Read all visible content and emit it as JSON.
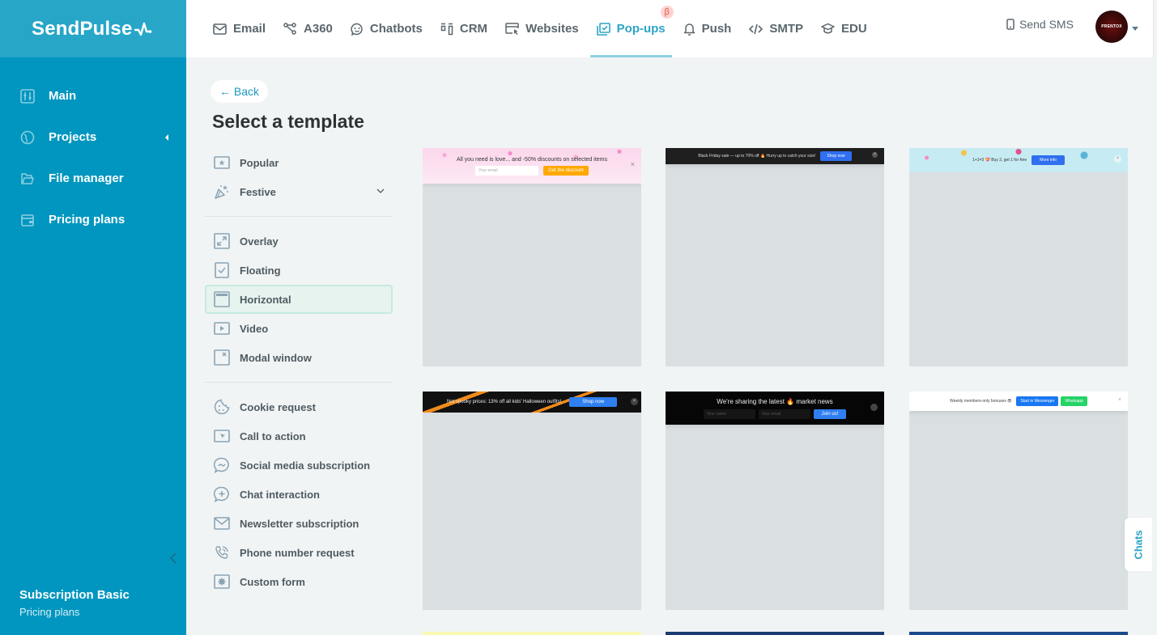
{
  "brand": {
    "name": "SendPulse",
    "primary": "#0096bf",
    "accent": "#2ba5c6"
  },
  "sidebar": {
    "items": [
      {
        "label": "Main",
        "icon": "sliders-icon"
      },
      {
        "label": "Projects",
        "icon": "globe-icon"
      },
      {
        "label": "File manager",
        "icon": "folder-icon"
      },
      {
        "label": "Pricing plans",
        "icon": "wallet-icon"
      }
    ],
    "plan": {
      "title": "Subscription Basic",
      "subtitle": "Pricing plans"
    }
  },
  "topnav": {
    "items": [
      {
        "label": "Email",
        "icon": "envelope-icon"
      },
      {
        "label": "A360",
        "icon": "flow-icon"
      },
      {
        "label": "Chatbots",
        "icon": "chatbot-icon"
      },
      {
        "label": "CRM",
        "icon": "crm-icon"
      },
      {
        "label": "Websites",
        "icon": "website-icon"
      },
      {
        "label": "Pop-ups",
        "icon": "popup-icon",
        "active": true,
        "badge": "β"
      },
      {
        "label": "Push",
        "icon": "bell-icon"
      },
      {
        "label": "SMTP",
        "icon": "code-icon"
      },
      {
        "label": "EDU",
        "icon": "graduation-cap-icon"
      }
    ],
    "send_sms": "Send SMS",
    "avatar_text": "PRENTOX"
  },
  "main": {
    "back": "← Back",
    "title": "Select a template",
    "categories_group1": [
      "Popular",
      "Festive"
    ],
    "categories_group2": [
      "Overlay",
      "Floating",
      "Horizontal",
      "Video",
      "Modal window"
    ],
    "categories_group3": [
      "Cookie request",
      "Call to action",
      "Social media subscription",
      "Chat interaction",
      "Newsletter subscription",
      "Phone number request",
      "Custom form"
    ],
    "active_category": "Horizontal"
  },
  "templates": [
    {
      "text": "All you need is love... and -50% discounts on selected items",
      "input": "Your email",
      "button": "Get the discount",
      "close": "×"
    },
    {
      "text": "Black Friday sale — up to 70% off 🔥 Hurry up to catch your size!",
      "button": "Shop now",
      "close": "×"
    },
    {
      "text": "1+1=3 💝 Buy 2, get 1 for free",
      "button": "More info",
      "close": "×"
    },
    {
      "text": "Not spooky prices: 13% off all kids' Halloween outfits!",
      "button": "Shop now",
      "close": "×"
    },
    {
      "text": "We're sharing the latest 🔥 market news",
      "input1": "Your name",
      "input2": "Your email",
      "button": "Join us!"
    },
    {
      "text": "Weekly members-only bonuses 😎",
      "button1": "Start in Messenger",
      "button2": "Whatsapp",
      "close": "×"
    }
  ],
  "chats_tab": "Chats"
}
